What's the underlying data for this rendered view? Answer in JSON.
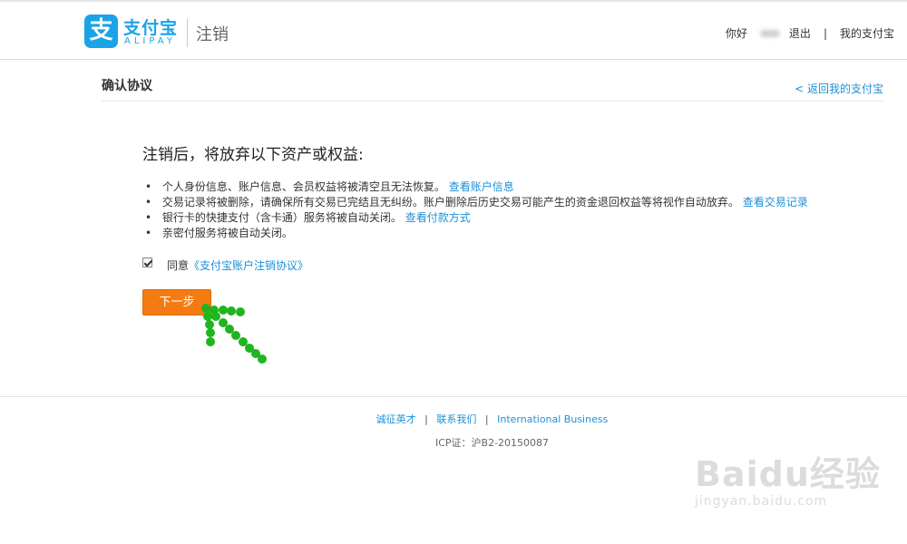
{
  "header": {
    "logo_glyph": "支",
    "brand_cn": "支付宝",
    "brand_en": "ALIPAY",
    "subtitle": "注销",
    "greeting": "你好",
    "logout": "退出",
    "separator": "|",
    "my_alipay": "我的支付宝"
  },
  "subheader": {
    "title": "确认协议",
    "back_link": "< 返回我的支付宝"
  },
  "main": {
    "title": "注销后，将放弃以下资产或权益:",
    "items": [
      {
        "text": "个人身份信息、账户信息、会员权益将被清空且无法恢复。",
        "link": "查看账户信息"
      },
      {
        "text": "交易记录将被删除，请确保所有交易已完结且无纠纷。账户删除后历史交易可能产生的资金退回权益等将视作自动放弃。",
        "link": "查看交易记录"
      },
      {
        "text": "银行卡的快捷支付（含卡通）服务将被自动关闭。",
        "link": "查看付款方式"
      },
      {
        "text": "亲密付服务将被自动关闭。",
        "link": ""
      }
    ],
    "agree_prefix": "同意",
    "agree_link": "《支付宝账户注销协议》",
    "agree_checked": true,
    "next_button": "下一步"
  },
  "footer": {
    "links": [
      "诚征英才",
      "联系我们",
      "International Business"
    ],
    "separator": "|",
    "icp": "ICP证：沪B2-20150087"
  },
  "watermark": {
    "main": "Baidu经验",
    "url": "jingyan.baidu.com"
  },
  "colors": {
    "brand_blue": "#1aa3e8",
    "link_blue": "#1e8fd8",
    "button_orange": "#f47b12",
    "annotation_green": "#1fb51f"
  }
}
